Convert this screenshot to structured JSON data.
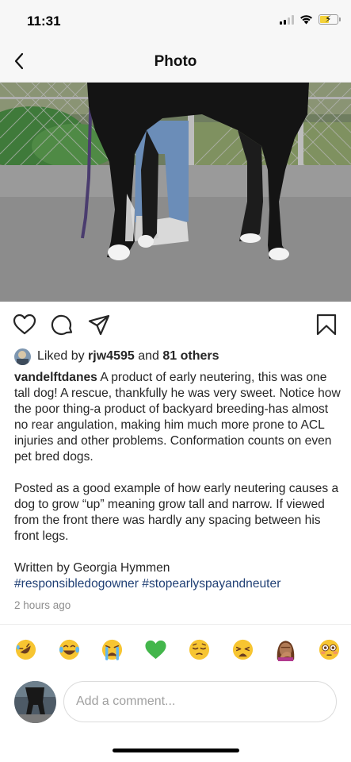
{
  "status_bar": {
    "time": "11:31",
    "battery_level": 0.5,
    "battery_color": "#f5d33a",
    "icons": [
      "signal-icon",
      "wifi-icon",
      "battery-charging-icon"
    ]
  },
  "nav": {
    "title": "Photo",
    "back_icon": "chevron-left-icon"
  },
  "post": {
    "photo_alt": "photo-of-black-dog-standing-beside-person",
    "actions": [
      "heart-icon",
      "comment-icon",
      "share-icon",
      "bookmark-icon"
    ],
    "likes": {
      "prefix": "Liked by ",
      "user": "rjw4595",
      "connector": " and ",
      "others": "81 others"
    },
    "caption": {
      "username": "vandelftdanes",
      "text": "A product of early neutering, this was one tall dog! A rescue, thankfully he was very sweet. Notice how the poor thing-a product of backyard breeding-has almost no rear angulation, making him much more prone to ACL injuries and other problems. Conformation counts on even pet bred dogs.",
      "paragraph2": "Posted as a good example of how early neutering causes a dog to grow “up” meaning grow tall and narrow. If viewed from the front there was hardly any spacing between his front legs.",
      "credit": "Written by Georgia Hymmen",
      "hashtag1": "#responsibledogowner",
      "hashtag2": "#stopearlyspayandneuter"
    },
    "timestamp": "2 hours ago"
  },
  "emoji_bar": [
    {
      "name": "rofl-emoji"
    },
    {
      "name": "tears-of-joy-emoji"
    },
    {
      "name": "crying-emoji"
    },
    {
      "name": "green-heart-emoji",
      "color": "#43b64b"
    },
    {
      "name": "pensive-emoji"
    },
    {
      "name": "weary-emoji"
    },
    {
      "name": "woman-facepalming-emoji"
    },
    {
      "name": "flushed-emoji"
    }
  ],
  "comment": {
    "placeholder": "Add a comment..."
  },
  "colors": {
    "hashtag": "#1f3f74",
    "timestamp": "#8e8e8e",
    "header_bg": "#f7f7f7"
  }
}
